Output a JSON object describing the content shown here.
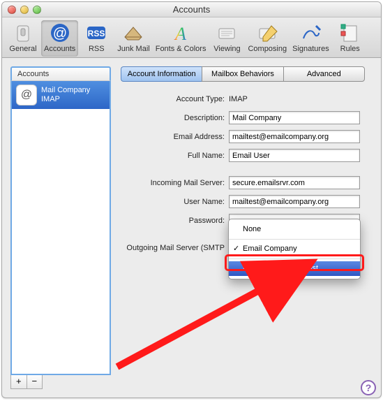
{
  "window": {
    "title": "Accounts"
  },
  "toolbar": {
    "items": [
      {
        "label": "General"
      },
      {
        "label": "Accounts"
      },
      {
        "label": "RSS"
      },
      {
        "label": "Junk Mail"
      },
      {
        "label": "Fonts & Colors"
      },
      {
        "label": "Viewing"
      },
      {
        "label": "Composing"
      },
      {
        "label": "Signatures"
      },
      {
        "label": "Rules"
      }
    ]
  },
  "sidebar": {
    "header": "Accounts",
    "account": {
      "name": "Mail Company",
      "proto": "IMAP"
    },
    "add": "+",
    "remove": "−"
  },
  "tabs": {
    "info": "Account Information",
    "mailbox": "Mailbox Behaviors",
    "advanced": "Advanced"
  },
  "form": {
    "account_type_label": "Account Type:",
    "account_type": "IMAP",
    "description_label": "Description:",
    "description": "Mail Company",
    "email_label": "Email Address:",
    "email": "mailtest@emailcompany.org",
    "fullname_label": "Full Name:",
    "fullname": "Email User",
    "incoming_label": "Incoming Mail Server:",
    "incoming": "secure.emailsrvr.com",
    "username_label": "User Name:",
    "username": "mailtest@emailcompany.org",
    "password_label": "Password:",
    "password": "•••••••••",
    "smtp_label": "Outgoing Mail Server (SMTP"
  },
  "menu": {
    "none": "None",
    "company": "Email Company",
    "edit": "Edit SMTP Server List…"
  },
  "help": "?"
}
